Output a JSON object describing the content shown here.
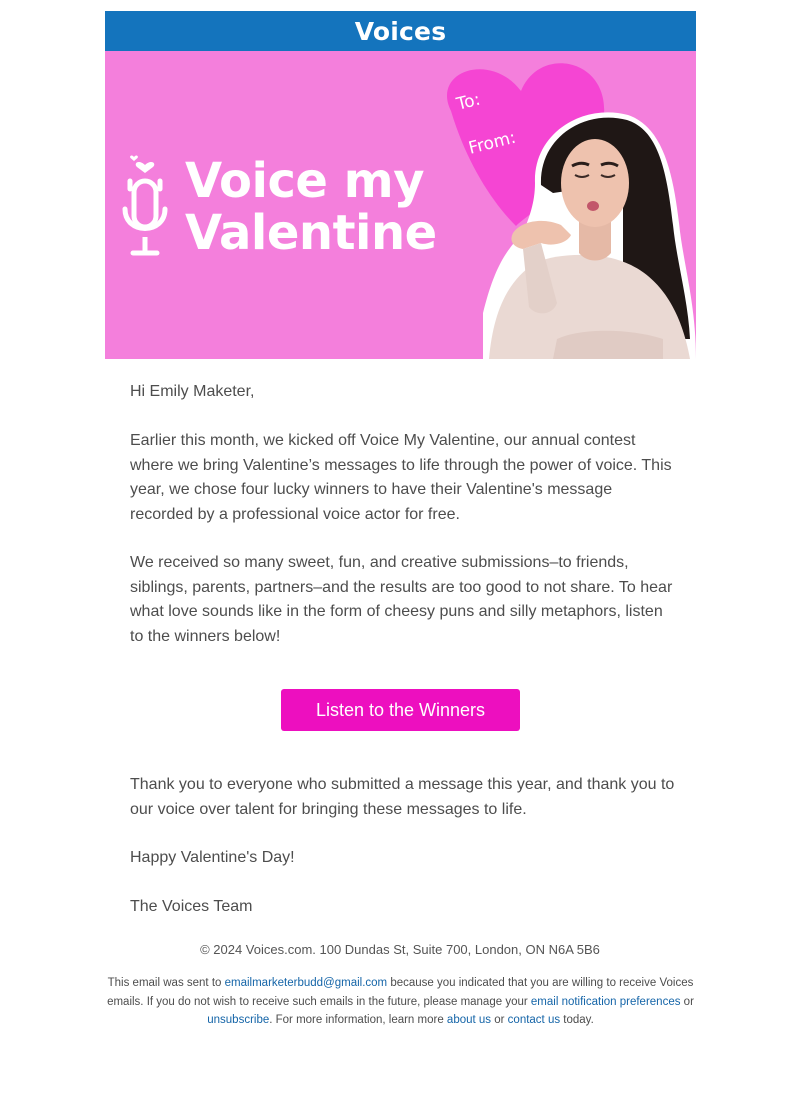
{
  "header": {
    "brand": "Voices",
    "brand_color": "#1474bd"
  },
  "hero": {
    "title_line1": "Voice my",
    "title_line2": "Valentine",
    "card_to": "To:",
    "card_from": "From:",
    "background_color": "#f47fdc",
    "heart_color": "#f545d3",
    "icons": [
      "microphone-icon",
      "heart-icon"
    ]
  },
  "body": {
    "greeting": "Hi Emily Maketer,",
    "intro": "Earlier this month, we kicked off Voice My Valentine, our annual contest where we bring Valentine’s messages to life through the power of voice. This year, we chose four lucky winners to have their Valentine's message recorded by a professional voice actor for free.",
    "submissions": "We received so many sweet, fun, and creative submissions–to friends, siblings, parents, partners–and the results are too good to not share. To hear what love sounds like in the form of cheesy puns and silly metaphors, listen to the winners below!",
    "cta_label": "Listen to the Winners",
    "cta_color": "#ed0fbf",
    "thanks": "Thank you to everyone who submitted a message this year, and thank you to our voice over talent for bringing these messages to life.",
    "happy": "Happy Valentine's Day!",
    "signoff": "The Voices Team"
  },
  "footer": {
    "address": "© 2024 Voices.com. 100 Dundas St, Suite 700, London, ON N6A 5B6",
    "legal_1": "This email was sent to ",
    "email_link": "emailmarketerbudd@gmail.com",
    "legal_2": " because you indicated that you are willing to receive Voices emails. If you do not wish to receive such emails in the future, please manage your ",
    "prefs_link": "email notification preferences",
    "legal_3": " or ",
    "unsubscribe_link": "unsubscribe",
    "legal_4": ". For more information, learn more ",
    "about_link": "about us",
    "legal_5": " or ",
    "contact_link": "contact us",
    "legal_6": " today.",
    "link_color": "#1565a8"
  }
}
